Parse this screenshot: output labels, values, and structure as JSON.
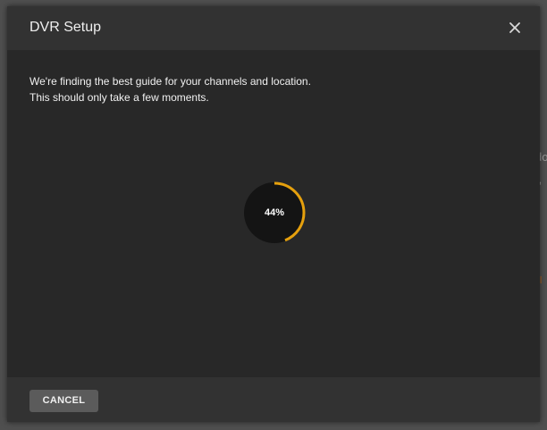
{
  "dialog": {
    "title": "DVR Setup",
    "close_icon": "close-icon",
    "message_line1": "We're finding the best guide for your channels and location.",
    "message_line2": "This should only take a few moments.",
    "progress": {
      "percent": 44,
      "label": "44%",
      "color": "#e5a00d"
    },
    "cancel_label": "CANCEL"
  },
  "background": {
    "peek_1": "do",
    "peek_2": "r,",
    "peek_3": "t",
    "peek_4": "ill"
  }
}
